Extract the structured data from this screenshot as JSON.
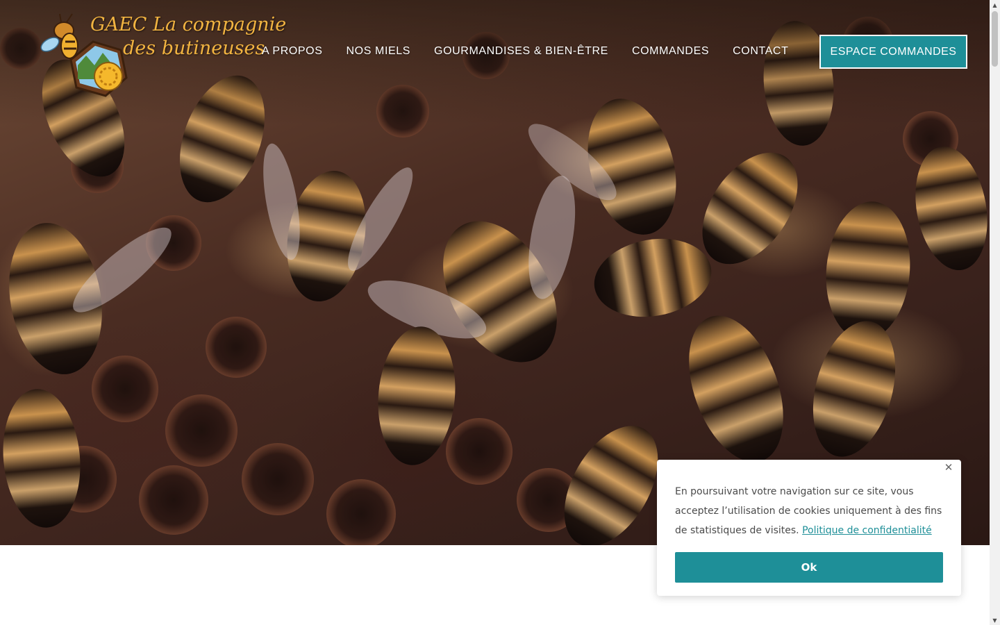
{
  "logo": {
    "line1": "GAEC La compagnie",
    "line2": "des butineuses"
  },
  "nav": {
    "items": [
      {
        "label": "A PROPOS"
      },
      {
        "label": "NOS MIELS"
      },
      {
        "label": "GOURMANDISES & BIEN-ÊTRE"
      },
      {
        "label": "COMMANDES"
      },
      {
        "label": "CONTACT"
      }
    ],
    "cta_label": "ESPACE COMMANDES"
  },
  "cookie": {
    "message": "En poursuivant votre navigation sur ce site, vous acceptez l’utilisation de cookies uniquement à des fins de statistiques de visites.",
    "policy_link": "Politique de confidentialité",
    "ok_label": "Ok",
    "close_icon": "close-icon"
  },
  "colors": {
    "accent": "#1e8f98",
    "logo_text": "#f2b441",
    "nav_text": "#ffffff"
  },
  "icons": {
    "hero_image": "bees-on-honeycomb-photo",
    "logo_emblem": "bee-hexagon-emblem",
    "scroll_up": "scroll-up-arrow-icon",
    "scroll_down": "scroll-down-arrow-icon"
  }
}
